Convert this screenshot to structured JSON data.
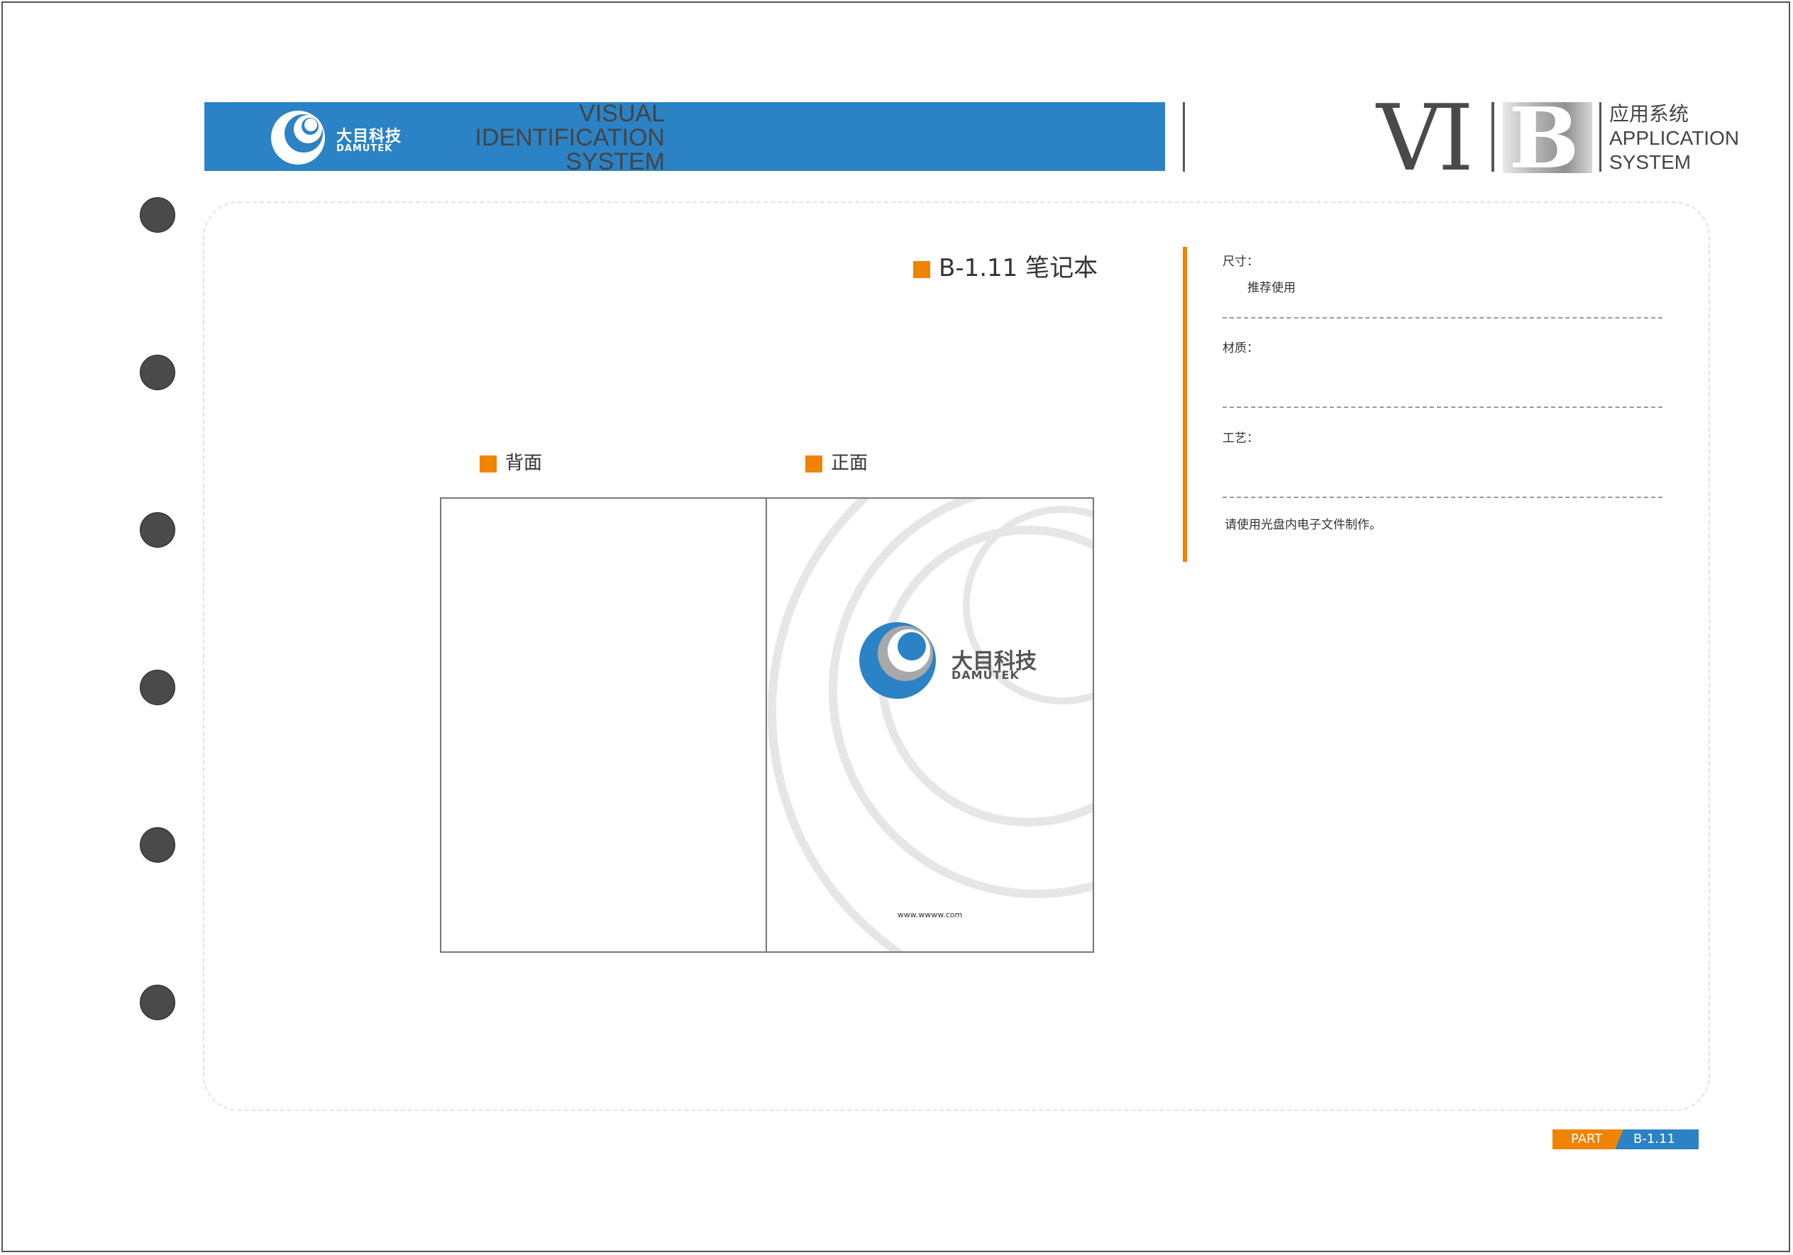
{
  "header": {
    "brand_cn": "大目科技",
    "brand_en": "DAMUTEK",
    "visual_lines": [
      "VISUAL",
      "IDENTIFICATION",
      "SYSTEM"
    ],
    "vi_letters": "VI",
    "b_letter": "B",
    "app_lines": [
      "应用系统",
      "APPLICATION",
      "SYSTEM"
    ]
  },
  "section": {
    "code_title": "B-1.11  笔记本"
  },
  "mockup": {
    "back_label": "背面",
    "front_label": "正面",
    "front_brand_cn": "大目科技",
    "front_brand_en": "DAMUTEK",
    "front_url": "www.wwww.com"
  },
  "specs": {
    "size_label": "尺寸：",
    "size_value": "推荐使用",
    "material_label": "材质：",
    "process_label": "工艺：",
    "note": "请使用光盘内电子文件制作。"
  },
  "footer": {
    "part_label": "PART",
    "part_code": "B-1.11"
  },
  "colors": {
    "brand_blue": "#2b82c5",
    "accent_orange": "#f08300",
    "ring_gray": "#e6e6e6"
  }
}
